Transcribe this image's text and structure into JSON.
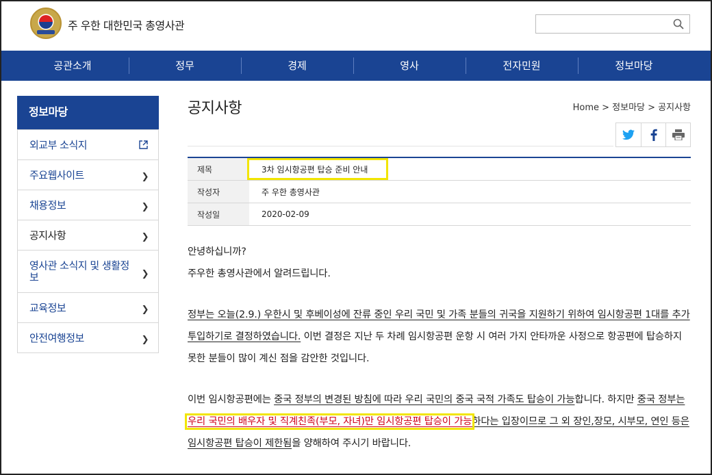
{
  "header": {
    "site_title": "주 우한 대한민국 총영사관",
    "search_placeholder": ""
  },
  "nav": {
    "items": [
      "공관소개",
      "정무",
      "경제",
      "영사",
      "전자민원",
      "정보마당"
    ]
  },
  "sidebar": {
    "title": "정보마당",
    "items": [
      {
        "label": "외교부 소식지",
        "icon": "external-link-icon"
      },
      {
        "label": "주요웹사이트",
        "icon": "chevron-right-icon"
      },
      {
        "label": "채용정보",
        "icon": "chevron-right-icon"
      },
      {
        "label": "공지사항",
        "icon": "chevron-right-icon"
      },
      {
        "label": "영사관 소식지 및 생활정보",
        "icon": "chevron-right-icon"
      },
      {
        "label": "교육정보",
        "icon": "chevron-right-icon"
      },
      {
        "label": "안전여행정보",
        "icon": "chevron-right-icon"
      }
    ]
  },
  "page": {
    "title": "공지사항",
    "breadcrumb": "Home > 정보마당 > 공지사항"
  },
  "share": {
    "buttons": [
      "twitter-icon",
      "facebook-icon",
      "print-icon"
    ]
  },
  "meta": {
    "title_label": "제목",
    "title_value": "3차 임시항공편 탑승 준비 안내",
    "author_label": "작성자",
    "author_value": "주 우한 총영사관",
    "date_label": "작성일",
    "date_value": "2020-02-09"
  },
  "body": {
    "greeting": "안녕하십니까?",
    "intro": "주우한 총영사관에서 알려드립니다.",
    "p1_underlined": "정부는 오늘(2.9.) 우한시 및 후베이성에 잔류 중인 우리 국민 및 가족 분들의 귀국을 지원하기 위하여 임시항공편 1대를 추가 투입하기로 결정하였습니다.",
    "p1_rest": " 이번 결정은 지난 두 차례 임시항공편 운항 시 여러 가지 안타까운 사정으로 항공편에 탑승하지 못한 분들이 많이 계신 점을 감안한 것입니다.",
    "p2_a": "이번 임시항공편에는 ",
    "p2_b": "중국 정부의 변경된 방침에 따라 우리 국민의 중국 국적 가족도 탑승이 가능",
    "p2_c": "합니다. 하지만 ",
    "p2_d": "중국 정부는 ",
    "p2_red": "우리 국민의 배우자 및 직계친족(부모, 자녀)만 임시항공편 탑승이 가능",
    "p2_e": "하다는 입장이므로 그 외 장인,장모, 시부모, 연인 등은 임시항공편 탑승이 제한됨",
    "p2_f": "을 양해하여 주시기 바랍니다."
  },
  "colors": {
    "brand": "#1a4493",
    "highlight": "#f2e500",
    "emphasis": "#d0021b"
  }
}
